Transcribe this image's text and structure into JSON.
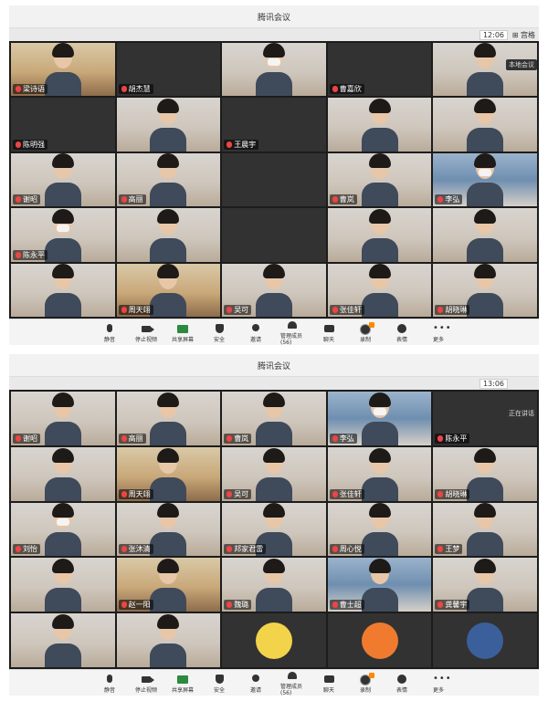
{
  "screens": [
    {
      "title": "腾讯会议",
      "time": "12:06",
      "layout_label": "⊞ 宫格",
      "popover": "本地会议",
      "tiles": [
        {
          "name": "梁诗语",
          "style": "warm",
          "person": true
        },
        {
          "name": "胡杰慧",
          "style": "dark-empty",
          "person": false
        },
        {
          "name": "",
          "style": "photo",
          "person": true,
          "mask": true
        },
        {
          "name": "曹嘉欣",
          "style": "dark-empty",
          "person": false
        },
        {
          "name": "",
          "style": "photo",
          "person": true
        },
        {
          "name": "陈明强",
          "style": "dark-empty",
          "person": false
        },
        {
          "name": "",
          "style": "photo",
          "person": true
        },
        {
          "name": "王晨宇",
          "style": "dark-empty",
          "person": false
        },
        {
          "name": "",
          "style": "photo",
          "person": true
        },
        {
          "name": "",
          "style": "photo",
          "person": true
        },
        {
          "name": "谢昭",
          "style": "photo",
          "person": true
        },
        {
          "name": "高丽",
          "style": "photo",
          "person": true
        },
        {
          "name": "",
          "style": "dark-empty",
          "person": false
        },
        {
          "name": "曹岚",
          "style": "photo",
          "person": true
        },
        {
          "name": "李弘",
          "style": "blue",
          "person": true,
          "mask": true
        },
        {
          "name": "陈永平",
          "style": "photo",
          "person": true,
          "mask": true
        },
        {
          "name": "",
          "style": "photo",
          "person": true
        },
        {
          "name": "",
          "style": "dark-empty",
          "person": false
        },
        {
          "name": "",
          "style": "photo",
          "person": true
        },
        {
          "name": "",
          "style": "photo",
          "person": true
        },
        {
          "name": "",
          "style": "photo",
          "person": true
        },
        {
          "name": "周天翊",
          "style": "warm",
          "person": true
        },
        {
          "name": "吴可",
          "style": "photo",
          "person": true
        },
        {
          "name": "张佳轩",
          "style": "photo",
          "person": true
        },
        {
          "name": "胡晓琳",
          "style": "photo",
          "person": true
        },
        {
          "name": "",
          "style": "photo",
          "person": true
        },
        {
          "name": "",
          "style": "dark-empty",
          "person": false
        },
        {
          "name": "",
          "style": "photo",
          "person": true
        },
        {
          "name": "",
          "style": "dark-empty",
          "person": false
        },
        {
          "name": "",
          "style": "photo",
          "person": true
        },
        {
          "name": "刘怡",
          "style": "photo",
          "person": true,
          "mask": true
        },
        {
          "name": "张沐清",
          "style": "photo",
          "person": true
        },
        {
          "name": "邦家君雷",
          "style": "photo",
          "person": true
        },
        {
          "name": "周心悦",
          "style": "photo",
          "person": true
        },
        {
          "name": "王梦",
          "style": "photo",
          "person": true
        },
        {
          "name": "",
          "style": "dark-empty",
          "person": false
        },
        {
          "name": "",
          "style": "photo",
          "person": true
        },
        {
          "name": "",
          "style": "dark-empty",
          "person": false
        },
        {
          "name": "",
          "style": "photo",
          "person": true
        },
        {
          "name": "",
          "style": "photo",
          "person": true
        },
        {
          "name": "",
          "style": "photo",
          "person": true
        },
        {
          "name": "",
          "style": "warm",
          "person": true
        },
        {
          "name": "",
          "style": "photo",
          "person": true
        },
        {
          "name": "",
          "style": "avatar",
          "person": false
        },
        {
          "name": "",
          "style": "avatar-yellow",
          "person": false
        }
      ]
    },
    {
      "title": "腾讯会议",
      "time": "13:06",
      "layout_label": "",
      "popover": "正在讲话",
      "tiles": [
        {
          "name": "谢昭",
          "style": "photo",
          "person": true
        },
        {
          "name": "高丽",
          "style": "photo",
          "person": true
        },
        {
          "name": "曹岚",
          "style": "photo",
          "person": true
        },
        {
          "name": "李弘",
          "style": "blue",
          "person": true,
          "mask": true
        },
        {
          "name": "陈永平",
          "style": "dark-empty",
          "person": false
        },
        {
          "name": "",
          "style": "photo",
          "person": true
        },
        {
          "name": "周天翊",
          "style": "warm",
          "person": true
        },
        {
          "name": "吴可",
          "style": "photo",
          "person": true
        },
        {
          "name": "张佳轩",
          "style": "photo",
          "person": true
        },
        {
          "name": "胡晓琳",
          "style": "photo",
          "person": true
        },
        {
          "name": "刘怡",
          "style": "photo",
          "person": true,
          "mask": true
        },
        {
          "name": "张沐清",
          "style": "photo",
          "person": true
        },
        {
          "name": "邦家君雷",
          "style": "photo",
          "person": true
        },
        {
          "name": "周心悦",
          "style": "photo",
          "person": true
        },
        {
          "name": "王梦",
          "style": "photo",
          "person": true
        },
        {
          "name": "",
          "style": "photo",
          "person": true
        },
        {
          "name": "赵一阳",
          "style": "warm",
          "person": true
        },
        {
          "name": "魏璐",
          "style": "photo",
          "person": true
        },
        {
          "name": "曹士超",
          "style": "blue",
          "person": true
        },
        {
          "name": "龚馨宇",
          "style": "photo",
          "person": true
        },
        {
          "name": "",
          "style": "photo",
          "person": true
        },
        {
          "name": "",
          "style": "photo",
          "person": true
        },
        {
          "name": "",
          "style": "avatar-yellow",
          "person": false
        },
        {
          "name": "",
          "style": "avatar-orange",
          "person": false
        },
        {
          "name": "",
          "style": "avatar-wave",
          "person": false
        }
      ]
    }
  ],
  "toolbar": [
    {
      "label": "静音",
      "icon": "microphone-icon"
    },
    {
      "label": "停止视频",
      "icon": "camera-icon"
    },
    {
      "label": "共享屏幕",
      "icon": "share-screen-icon"
    },
    {
      "label": "安全",
      "icon": "shield-icon"
    },
    {
      "label": "邀请",
      "icon": "invite-icon"
    },
    {
      "label": "管理成员(56)",
      "icon": "members-icon"
    },
    {
      "label": "聊天",
      "icon": "chat-icon"
    },
    {
      "label": "录制",
      "icon": "record-icon"
    },
    {
      "label": "表情",
      "icon": "emoji-icon"
    },
    {
      "label": "更多",
      "icon": "more-icon"
    }
  ],
  "colors": {
    "accent": "#ff8800",
    "share": "#2b8a3e"
  }
}
